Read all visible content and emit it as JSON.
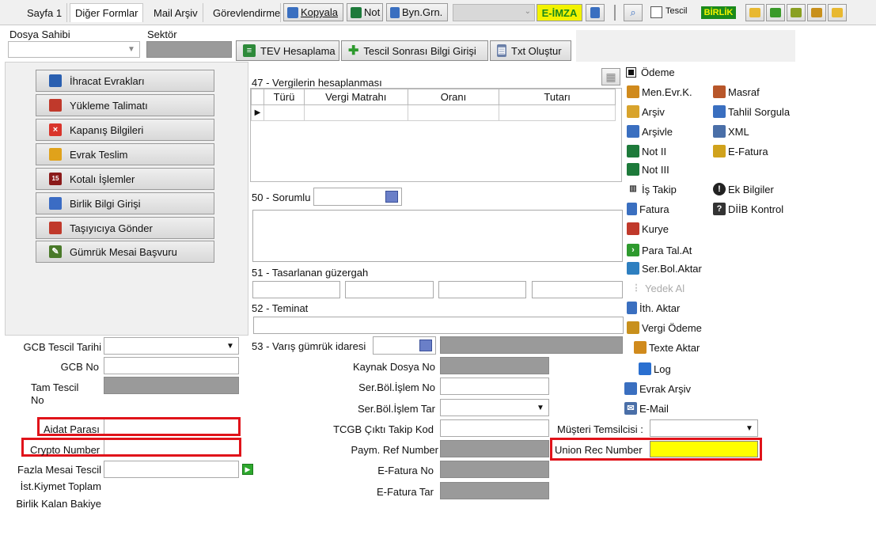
{
  "toolbar": {
    "tabs": [
      "Sayfa 1",
      "Diğer Formlar",
      "Mail Arşiv",
      "Görevlendirme"
    ],
    "kopyala_label": "Kopyala",
    "not_label": "Not",
    "byn_label": "Byn.Grn.",
    "eimza_label": "E-İMZA",
    "tescil_label": "Tescil",
    "birlik_label": "BİRLİK"
  },
  "header": {
    "dosya_sahibi_label": "Dosya Sahibi",
    "sektor_label": "Sektör",
    "tev_label": "TEV Hesaplama",
    "tescil_sonrasi_label": "Tescil Sonrası Bilgi Girişi",
    "txt_label": "Txt Oluştur"
  },
  "sidebar": {
    "items": [
      {
        "label": "İhracat Evrakları",
        "icon": "document-icon",
        "color": "#2a5fb0"
      },
      {
        "label": "Yükleme Talimatı",
        "icon": "truck-icon",
        "color": "#c0392b"
      },
      {
        "label": "Kapanış Bilgileri",
        "icon": "close-doc-icon",
        "color": "#d9342b"
      },
      {
        "label": "Evrak Teslim",
        "icon": "folder-icon",
        "color": "#e0a21b"
      },
      {
        "label": "Kotalı İşlemler",
        "icon": "calendar-icon",
        "color": "#8b1a1a"
      },
      {
        "label": "Birlik Bilgi Girişi",
        "icon": "building-icon",
        "color": "#3b6cc4"
      },
      {
        "label": "Taşıyıcıya Gönder",
        "icon": "truck-send-icon",
        "color": "#c0392b"
      },
      {
        "label": "Gümrük Mesai Başvuru",
        "icon": "pencil-doc-icon",
        "color": "#4a7a2a"
      }
    ]
  },
  "tax": {
    "title": "47 - Vergilerin hesaplanması",
    "columns": [
      "Türü",
      "Vergi Matrahı",
      "Oranı",
      "Tutarı"
    ]
  },
  "fields": {
    "sorumlu": "50 - Sorumlu",
    "guzergah": "51 - Tasarlanan güzergah",
    "teminat": "52 - Teminat",
    "varis": "53 - Varış gümrük idaresi",
    "kaynak": "Kaynak Dosya No",
    "serbol_no": "Ser.Böl.İşlem No",
    "serbol_tar": "Ser.Böl.İşlem Tar",
    "tcgb": "TCGB Çıktı Takip Kod",
    "paym": "Paym. Ref Number",
    "efatura_no": "E-Fatura No",
    "efatura_tar": "E-Fatura Tar",
    "musteri": "Müşteri Temsilcisi :",
    "union": "Union Rec Number",
    "gcb_tarih": "GCB Tescil Tarihi",
    "gcb_no": "GCB No",
    "tam_tescil": "Tam Tescil",
    "tam_tescil_no": "No",
    "aidat": "Aidat Parası",
    "crypto": "Crypto Number",
    "fazla_mesai": "Fazla Mesai Tescil",
    "ist_kiymet": "İst.Kiymet Toplam",
    "birlik_kalan": "Birlik Kalan Bakiye"
  },
  "right_menu": {
    "odeme": "Ödeme",
    "col1": [
      {
        "label": "Men.Evr.K.",
        "icon": "men-evr-icon",
        "color": "#d08a1c"
      },
      {
        "label": "Arşiv",
        "icon": "archive-icon",
        "color": "#d8a32c"
      },
      {
        "label": "Arşivle",
        "icon": "archive-add-icon",
        "color": "#3a6fc0"
      },
      {
        "label": "Not II",
        "icon": "note-icon",
        "color": "#1d7a3a"
      },
      {
        "label": "Not III",
        "icon": "note-icon",
        "color": "#1d7a3a"
      },
      {
        "label": "İş Takip",
        "icon": "barcode-icon",
        "color": "#333333"
      },
      {
        "label": "Fatura",
        "icon": "invoice-icon",
        "color": "#3a6fc0"
      },
      {
        "label": "Kurye",
        "icon": "courier-icon",
        "color": "#c0392b"
      },
      {
        "label": "Para Tal.At",
        "icon": "arrow-right-icon",
        "color": "#2e9a2e"
      },
      {
        "label": "Ser.Bol.Aktar",
        "icon": "transfer-icon",
        "color": "#2e7fc0"
      },
      {
        "label": "Yedek Al",
        "icon": "backup-icon",
        "color": "#bbbbbb"
      },
      {
        "label": "İth. Aktar",
        "icon": "import-icon",
        "color": "#3a6fc0"
      },
      {
        "label": "Vergi Ödeme",
        "icon": "tax-pay-icon",
        "color": "#c8901c"
      },
      {
        "label": "Texte Aktar",
        "icon": "text-export-icon",
        "color": "#d08a1c"
      },
      {
        "label": "Log",
        "icon": "log-icon",
        "color": "#2a6fd0"
      },
      {
        "label": "Evrak Arşiv",
        "icon": "doc-archive-icon",
        "color": "#3a6fc0"
      },
      {
        "label": "E-Mail",
        "icon": "mail-icon",
        "color": "#4a6fa8"
      }
    ],
    "col2": [
      {
        "label": "Masraf",
        "icon": "expense-icon",
        "color": "#b8562a"
      },
      {
        "label": "Tahlil Sorgula",
        "icon": "query-icon",
        "color": "#3a6fc0"
      },
      {
        "label": "XML",
        "icon": "xml-icon",
        "color": "#4a6fa8"
      },
      {
        "label": "E-Fatura",
        "icon": "efatura-icon",
        "color": "#d0a21c"
      },
      {
        "label": "Ek Bilgiler",
        "icon": "info-icon",
        "color": "#222222"
      },
      {
        "label": "DİİB Kontrol",
        "icon": "question-icon",
        "color": "#333333"
      }
    ]
  }
}
